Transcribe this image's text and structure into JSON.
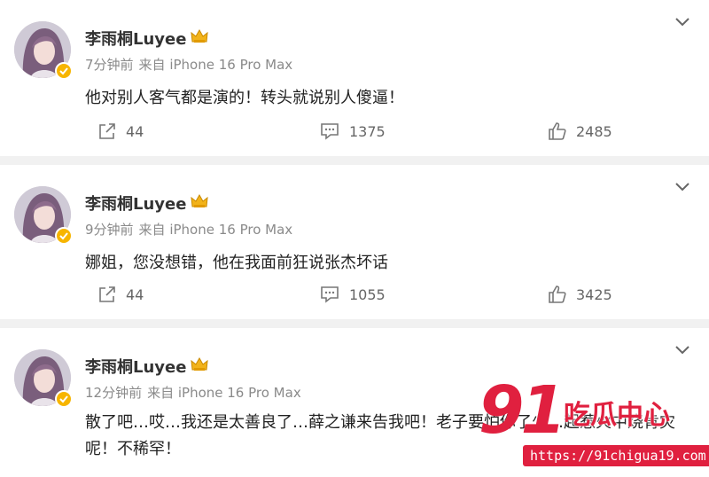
{
  "posts": [
    {
      "username": "李雨桐Luyee",
      "time": "7分钟前",
      "source": "来自 iPhone 16 Pro Max",
      "content": "他对别人客气都是演的！转头就说别人傻逼！",
      "shares": "44",
      "comments": "1375",
      "likes": "2485"
    },
    {
      "username": "李雨桐Luyee",
      "time": "9分钟前",
      "source": "来自 iPhone 16 Pro Max",
      "content": "娜姐，您没想错，他在我面前狂说张杰坏话",
      "shares": "44",
      "comments": "1055",
      "likes": "3425"
    },
    {
      "username": "李雨桐Luyee",
      "time": "12分钟前",
      "source": "来自 iPhone 16 Pro Max",
      "content": "散了吧…哎…我还是太善良了…薛之谦来告我吧！老子要怕你了少…起惹火中烧肯灾呢！不稀罕！"
    }
  ],
  "watermark": {
    "number": "91",
    "text": "吃瓜中心",
    "url": "https://91chigua19.com"
  },
  "icons": {
    "share": "share-icon",
    "comment": "comment-icon",
    "like": "like-icon",
    "more": "chevron-down-icon",
    "badge": "verified-badge-icon",
    "crown": "crown-icon"
  },
  "colors": {
    "verified": "#f7b500",
    "watermark": "#e0203f",
    "meta": "#8a8a8a"
  }
}
